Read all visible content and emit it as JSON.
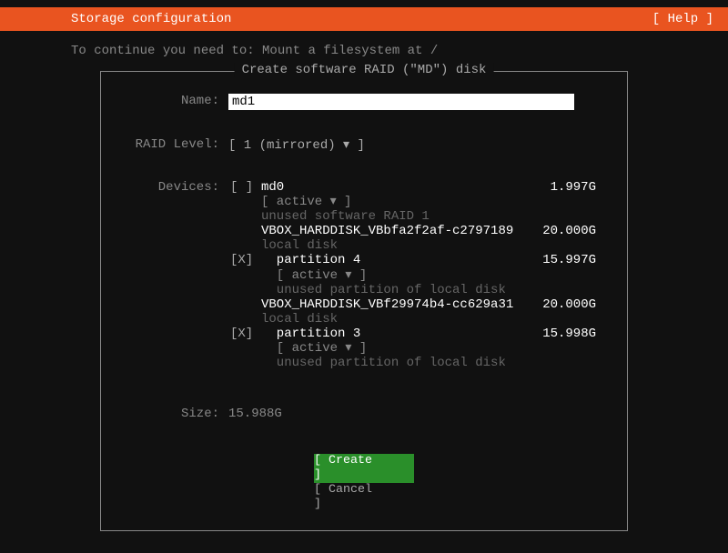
{
  "topbar": {
    "title": "Storage configuration",
    "help": "[ Help ]"
  },
  "hint": "To continue you need to: Mount a filesystem at /",
  "dialog": {
    "title": "Create software RAID (\"MD\") disk",
    "name_label": "Name:",
    "name_value": "md1",
    "raid_label": "RAID Level:",
    "raid_value": "[ 1 (mirrored)  ▾ ]",
    "devices_label": "Devices:",
    "devices": [
      {
        "checked": "[ ]",
        "name": "md0",
        "size": "1.997G",
        "status": "[ active ▾ ]",
        "desc": "unused software RAID 1",
        "header": false,
        "indent": false
      },
      {
        "checked": "",
        "name": "VBOX_HARDDISK_VBbfa2f2af-c2797189",
        "size": "20.000G",
        "status": "",
        "desc": "local disk",
        "header": true,
        "indent": false
      },
      {
        "checked": "[X]",
        "name": "partition 4",
        "size": "15.997G",
        "status": "[ active ▾ ]",
        "desc": "unused partition of local disk",
        "header": false,
        "indent": true
      },
      {
        "checked": "",
        "name": "VBOX_HARDDISK_VBf29974b4-cc629a31",
        "size": "20.000G",
        "status": "",
        "desc": "local disk",
        "header": true,
        "indent": false
      },
      {
        "checked": "[X]",
        "name": "partition 3",
        "size": "15.998G",
        "status": "[ active ▾ ]",
        "desc": "unused partition of local disk",
        "header": false,
        "indent": true
      }
    ],
    "size_label": "Size:",
    "size_value": "15.988G",
    "create": "Create",
    "cancel": "Cancel"
  }
}
